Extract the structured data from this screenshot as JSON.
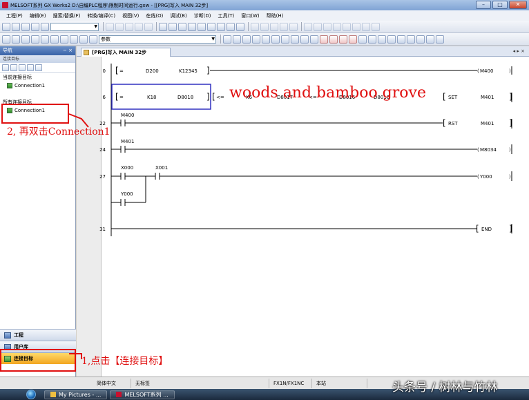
{
  "window": {
    "title": "MELSOFT系列 GX Works2 D:\\自编PLC程序\\限制时间运行.gxw - [[PRG]写入 MAIN 32步]",
    "controls": [
      "–",
      "□",
      "✕"
    ]
  },
  "menubar": {
    "items": [
      "工程(P)",
      "编辑(E)",
      "搜索/替换(F)",
      "转换/编译(C)",
      "视图(V)",
      "在线(O)",
      "调试(B)",
      "诊断(D)",
      "工具(T)",
      "窗口(W)",
      "帮助(H)"
    ]
  },
  "toolbar": {
    "combo_value": "参数"
  },
  "navigation": {
    "header": "导航",
    "header_pins": "− ×",
    "sub_header": "连接目标",
    "current_section": "当前连接目标",
    "current_connection": "Connection1",
    "all_section": "所有连接目标",
    "all_connection": "Connection1",
    "bottom_buttons": [
      "工程",
      "用户库",
      "连接目标"
    ]
  },
  "document_tab": {
    "label": "[PRG]写入 MAIN 32步",
    "nav_arrows": "◂ ▸ ×"
  },
  "ladder": {
    "rungs": [
      {
        "step": "0",
        "op": "=",
        "arg1": "D200",
        "arg2": "K12345",
        "coil": "M400"
      },
      {
        "step": "6",
        "op": "=",
        "arg1": "K18",
        "arg2": "D8018",
        "coil_prefix": "SET",
        "coil": "M401"
      },
      {
        "step": "22",
        "contact": "M400",
        "coil_prefix": "RST",
        "coil": "M401"
      },
      {
        "step": "24",
        "contact": "M401",
        "coil": "M8034"
      },
      {
        "step": "27",
        "contact": "X000",
        "contact2": "X001",
        "parallel": "Y000",
        "coil": "Y000"
      },
      {
        "step": "31",
        "coil": "END"
      }
    ],
    "rung6_extra": [
      "<=",
      "K6",
      "D8017",
      "<=",
      "D8016",
      "D8016"
    ]
  },
  "status_bar": {
    "cells": [
      "简体中文",
      "无标签",
      "FX1N/FX1NC",
      "本站"
    ]
  },
  "taskbar": {
    "buttons": [
      "My Pictures - ...",
      "MELSOFT系列 ..."
    ]
  },
  "annotations": {
    "step2": "2, 再双击Connection1",
    "step1": "1,点击【连接目标】",
    "overlay": "woods and bamboo grove",
    "watermark": "头条号 / 树林与竹林"
  },
  "colors": {
    "annotation_red": "#e01010",
    "selection_blue": "#3030c0",
    "active_nav": "#f2a620"
  }
}
